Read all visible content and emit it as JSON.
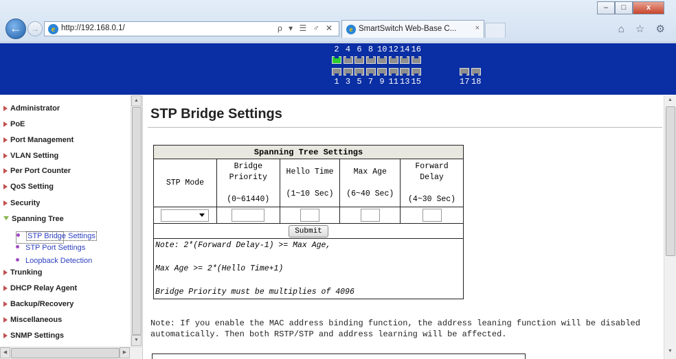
{
  "browser": {
    "url": "http://192.168.0.1/",
    "address_tools": "ρ ▾ ☰ ♂ ✕",
    "tab_title": "SmartSwitch Web-Base C...",
    "tab_close": "×",
    "window_buttons": [
      "–",
      "□",
      "x"
    ],
    "right_icons": [
      "home-icon",
      "star-icon",
      "gear-icon"
    ],
    "right_icon_glyphs": "⌂ ☆ ⚙"
  },
  "switch_panel": {
    "top_ports": [
      "2",
      "4",
      "6",
      "8",
      "10",
      "12",
      "14",
      "16"
    ],
    "bottom_ports": [
      "1",
      "3",
      "5",
      "7",
      "9",
      "11",
      "13",
      "15"
    ],
    "sfp_ports": [
      "17",
      "18"
    ],
    "linked_ports": [
      "2"
    ],
    "link_color": "#2ecc2e",
    "banner_color": "#0a2ea3"
  },
  "sidebar": {
    "items": [
      {
        "label": "Administrator"
      },
      {
        "label": "PoE"
      },
      {
        "label": "Port Management"
      },
      {
        "label": "VLAN Setting"
      },
      {
        "label": "Per Port Counter"
      },
      {
        "label": "QoS Setting"
      },
      {
        "label": "Security"
      },
      {
        "label": "Spanning Tree",
        "expanded": true
      },
      {
        "label": "Trunking"
      },
      {
        "label": "DHCP Relay Agent"
      },
      {
        "label": "Backup/Recovery"
      },
      {
        "label": "Miscellaneous"
      },
      {
        "label": "SNMP Settings"
      }
    ],
    "subitems": [
      {
        "label": "STP Bridge Settings",
        "selected": true
      },
      {
        "label": "STP Port Settings"
      },
      {
        "label": "Loopback Detection"
      }
    ]
  },
  "main": {
    "title": "STP Bridge Settings",
    "table": {
      "caption": "Spanning Tree Settings",
      "columns": [
        {
          "name": "STP Mode",
          "range": ""
        },
        {
          "name": "Bridge Priority",
          "range": "(0~61440)"
        },
        {
          "name": "Hello Time",
          "range": "(1~10 Sec)"
        },
        {
          "name": "Max Age",
          "range": "(6~40 Sec)"
        },
        {
          "name": "Forward Delay",
          "range": "(4~30 Sec)"
        }
      ],
      "stp_mode_value": "",
      "bridge_priority_value": "",
      "hello_time_value": "",
      "max_age_value": "",
      "forward_delay_value": "",
      "submit_label": "Submit",
      "notes": [
        "Note: 2*(Forward Delay-1) >= Max Age,",
        "Max Age >= 2*(Hello Time+1)",
        "Bridge Priority must be multiplies of 4096"
      ]
    },
    "note_line1": "Note: If you enable the MAC address binding function, the address leaning function will be disabled",
    "note_line2": "automatically. Then both RSTP/STP and address learning will be affected."
  }
}
